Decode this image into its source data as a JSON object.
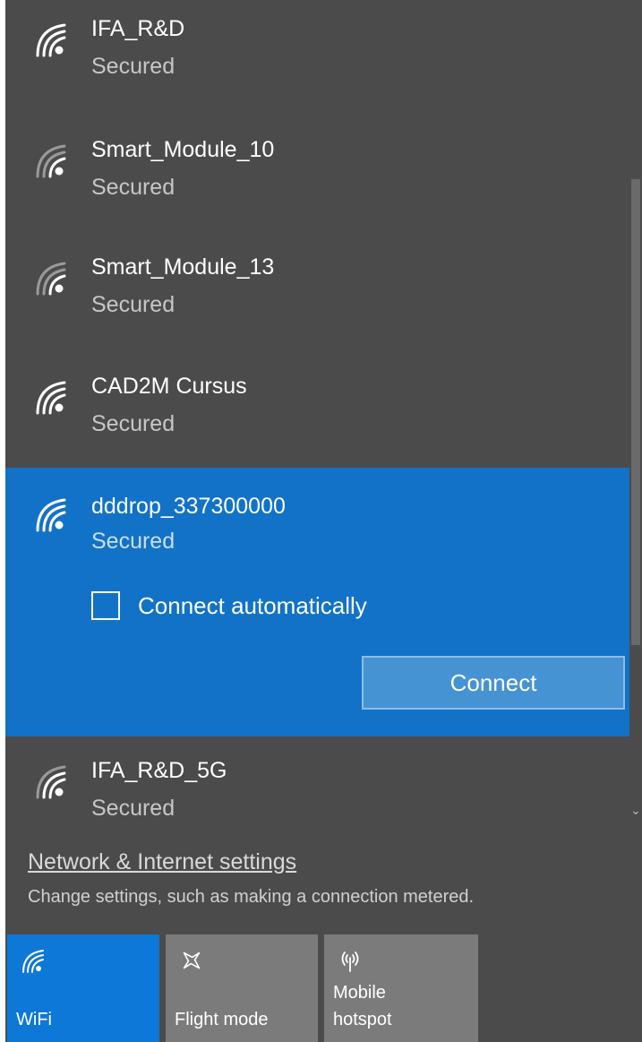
{
  "networks": [
    {
      "ssid": "IFA_R&D",
      "status": "Secured"
    },
    {
      "ssid": "Smart_Module_10",
      "status": "Secured"
    },
    {
      "ssid": "Smart_Module_13",
      "status": "Secured"
    },
    {
      "ssid": "CAD2M Cursus",
      "status": "Secured"
    },
    {
      "ssid": "dddrop_337300000",
      "status": "Secured",
      "selected": true
    },
    {
      "ssid": "IFA_R&D_5G",
      "status": "Secured"
    }
  ],
  "selected_network": {
    "auto_connect_label": "Connect automatically",
    "auto_connect_checked": false,
    "connect_label": "Connect"
  },
  "settings": {
    "link_label": "Network & Internet settings",
    "description": "Change settings, such as making a connection metered."
  },
  "quick_actions": {
    "wifi_label": "WiFi",
    "flight_label": "Flight mode",
    "hotspot_line1": "Mobile",
    "hotspot_line2": "hotspot"
  },
  "icons": {
    "wifi": "wifi-icon",
    "airplane": "airplane-icon",
    "hotspot": "hotspot-icon",
    "scroll_down": "chevron-down-icon"
  },
  "colors": {
    "panel": "#4b4b4b",
    "selected": "#1272c7",
    "wifi_tile": "#0d78d7",
    "tile": "#7b7b7b"
  }
}
